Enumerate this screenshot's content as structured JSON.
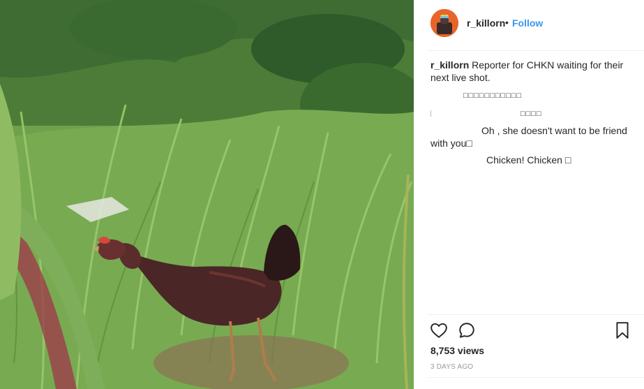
{
  "post": {
    "username": "r_killorn",
    "follow_label": "Follow",
    "separator_dot": "•"
  },
  "caption": {
    "username": "r_killorn",
    "line1_text": " Reporter for CHKN waiting for their",
    "line2_text": "next live shot.",
    "line3_text": "□□□□□□□□□□□",
    "line4_text": "□□□□",
    "line5_text": "Oh , she doesn't want to be friend",
    "line6_text": "with you□",
    "line7_text": "Chicken! Chicken □"
  },
  "stats": {
    "views": "8,753 views",
    "date": "3 DAYS AGO"
  },
  "icons": {
    "like": "heart-icon",
    "comment": "comment-icon",
    "save": "bookmark-icon"
  },
  "colors": {
    "follow": "#3897f0",
    "avatar_bg": "#e8642a",
    "text": "#262626",
    "muted": "#999999"
  }
}
